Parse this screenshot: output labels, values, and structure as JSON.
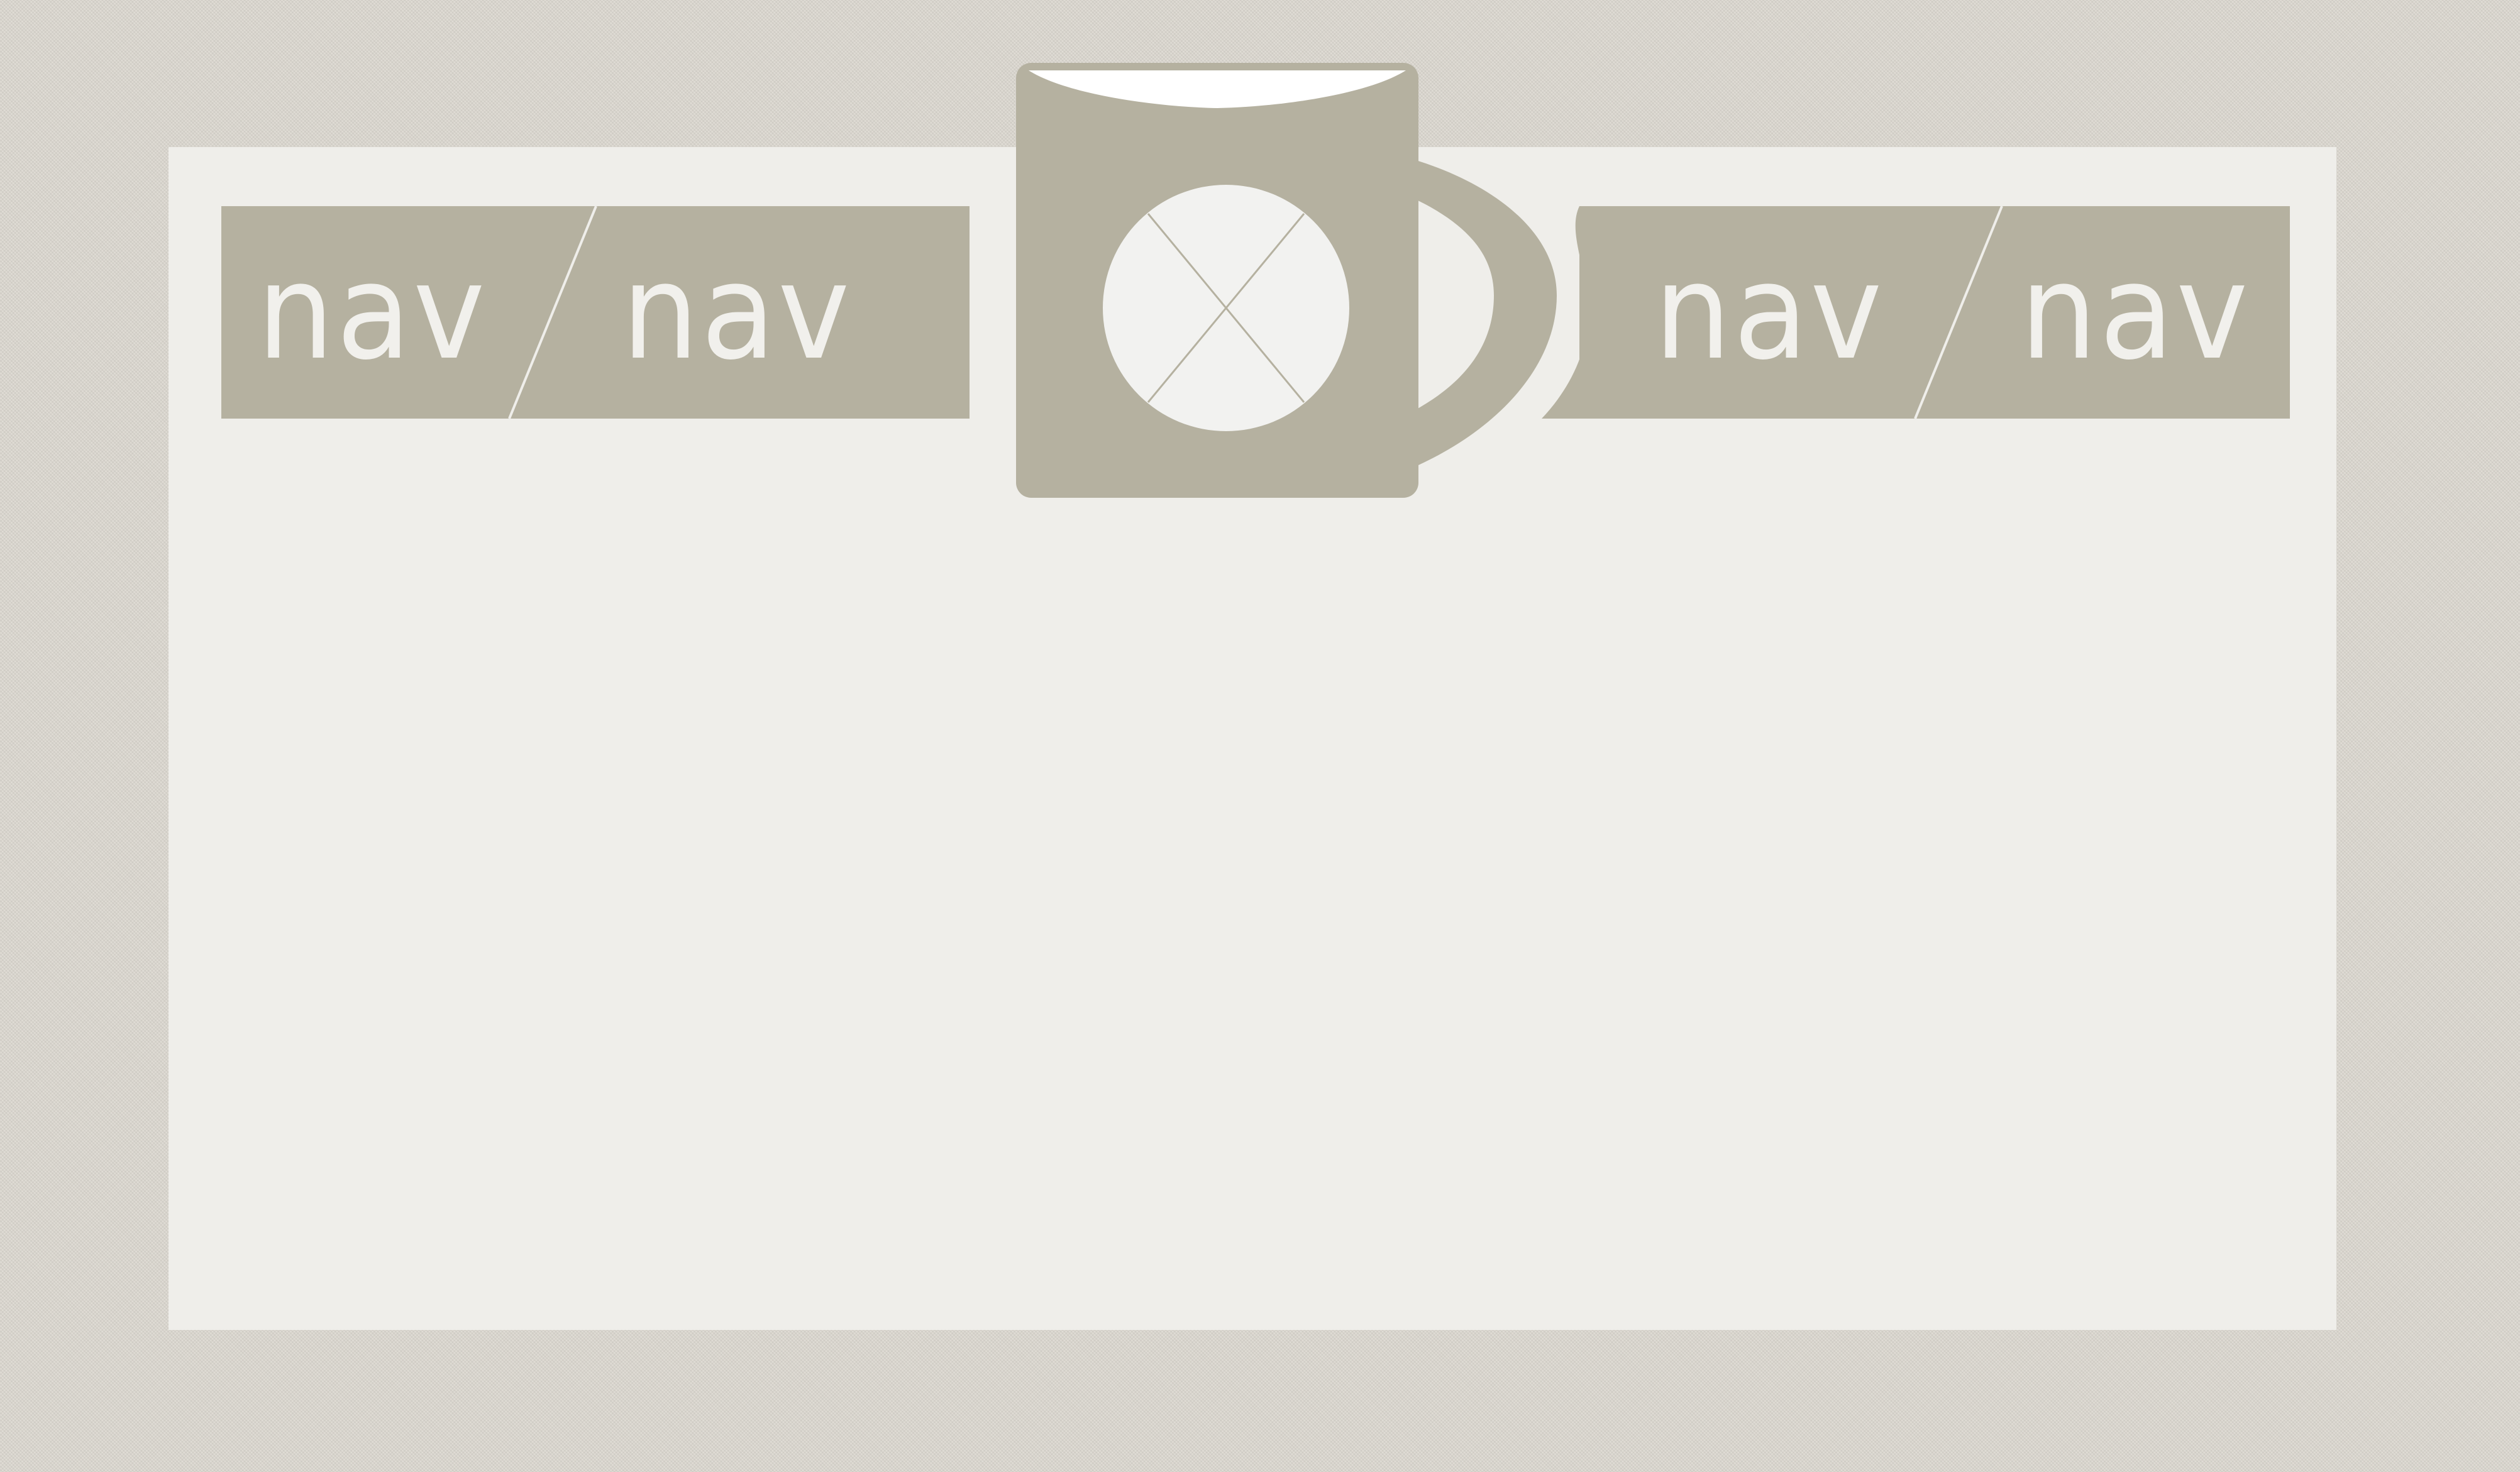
{
  "nav_left": {
    "items": [
      {
        "label": "nav"
      },
      {
        "label": "nav"
      }
    ]
  },
  "nav_right": {
    "items": [
      {
        "label": "nav"
      },
      {
        "label": "nav"
      }
    ]
  },
  "logo": {
    "icon": "coffee-mug-icon"
  },
  "colors": {
    "background": "#ddd9d1",
    "panel": "#efeeea",
    "accent": "#b5b1a0",
    "text": "#f1f0ec"
  }
}
